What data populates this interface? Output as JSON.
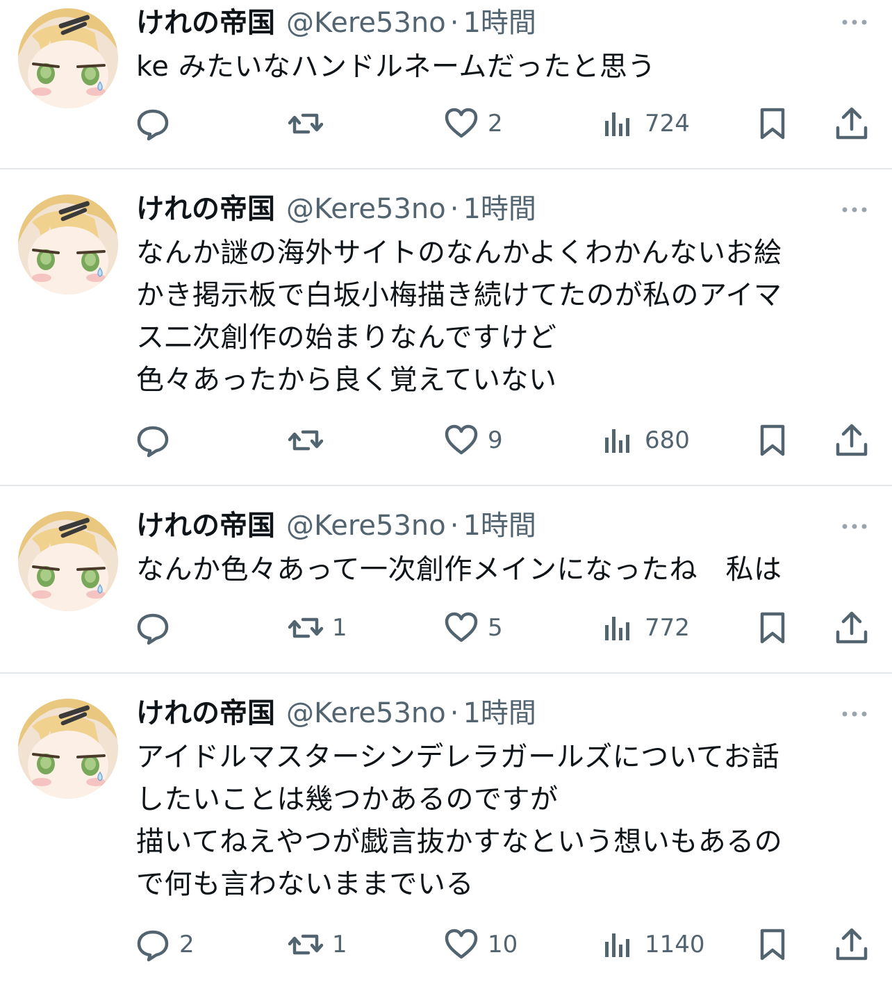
{
  "tweets": [
    {
      "author": "けれの帝国",
      "handle": "@Kere53no",
      "separator": "·",
      "time": "1時間",
      "text": "ke みたいなハンドルネームだったと思う",
      "replies": "",
      "retweets": "",
      "likes": "2",
      "views": "724"
    },
    {
      "author": "けれの帝国",
      "handle": "@Kere53no",
      "separator": "·",
      "time": "1時間",
      "text": "なんか謎の海外サイトのなんかよくわかんないお絵\nかき掲示板で白坂小梅描き続けてたのが私のアイマ\nス二次創作の始まりなんですけど\n色々あったから良く覚えていない",
      "replies": "",
      "retweets": "",
      "likes": "9",
      "views": "680"
    },
    {
      "author": "けれの帝国",
      "handle": "@Kere53no",
      "separator": "·",
      "time": "1時間",
      "text": "なんか色々あって一次創作メインになったね　私は",
      "replies": "",
      "retweets": "1",
      "likes": "5",
      "views": "772"
    },
    {
      "author": "けれの帝国",
      "handle": "@Kere53no",
      "separator": "·",
      "time": "1時間",
      "text": "アイドルマスターシンデレラガールズについてお話\nしたいことは幾つかあるのですが\n描いてねえやつが戯言抜かすなという想いもあるの\nで何も言わないままでいる",
      "replies": "2",
      "retweets": "1",
      "likes": "10",
      "views": "1140"
    }
  ],
  "icons": {
    "reply": "speech-bubble",
    "retweet": "retweet-arrows",
    "like": "heart-outline",
    "views": "bar-chart",
    "bookmark": "bookmark-outline",
    "share": "upload-arrow",
    "more": "three-dots"
  },
  "colors": {
    "text": "#0f1419",
    "secondary": "#536471",
    "divider": "#e4e8eb"
  }
}
